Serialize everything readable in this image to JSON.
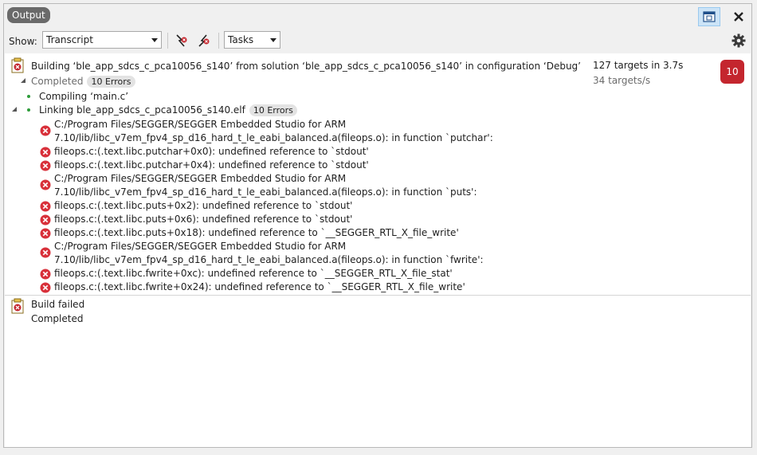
{
  "panel": {
    "title": "Output"
  },
  "toolbar": {
    "show_label": "Show:",
    "show_value": "Transcript",
    "tasks_value": "Tasks"
  },
  "build": {
    "header": "Building ‘ble_app_sdcs_c_pca10056_s140’ from solution ‘ble_app_sdcs_c_pca10056_s140’ in configuration ‘Debug’",
    "targets": "127 targets in 3.7s",
    "rate": "34 targets/s",
    "error_count": "10",
    "status": "Completed",
    "status_badge": "10 Errors",
    "compile": "Compiling ‘main.c’",
    "link": "Linking ble_app_sdcs_c_pca10056_s140.elf",
    "link_badge": "10 Errors"
  },
  "errors": [
    {
      "line1": "C:/Program Files/SEGGER/SEGGER Embedded Studio for ARM",
      "line2": "7.10/lib/libc_v7em_fpv4_sp_d16_hard_t_le_eabi_balanced.a(fileops.o): in function `putchar':"
    },
    {
      "line1": "fileops.c:(.text.libc.putchar+0x0): undefined reference to `stdout'"
    },
    {
      "line1": "fileops.c:(.text.libc.putchar+0x4): undefined reference to `stdout'"
    },
    {
      "line1": "C:/Program Files/SEGGER/SEGGER Embedded Studio for ARM",
      "line2": "7.10/lib/libc_v7em_fpv4_sp_d16_hard_t_le_eabi_balanced.a(fileops.o): in function `puts':"
    },
    {
      "line1": "fileops.c:(.text.libc.puts+0x2): undefined reference to `stdout'"
    },
    {
      "line1": "fileops.c:(.text.libc.puts+0x6): undefined reference to `stdout'"
    },
    {
      "line1": "fileops.c:(.text.libc.puts+0x18): undefined reference to `__SEGGER_RTL_X_file_write'"
    },
    {
      "line1": "C:/Program Files/SEGGER/SEGGER Embedded Studio for ARM",
      "line2": "7.10/lib/libc_v7em_fpv4_sp_d16_hard_t_le_eabi_balanced.a(fileops.o): in function `fwrite':"
    },
    {
      "line1": "fileops.c:(.text.libc.fwrite+0xc): undefined reference to `__SEGGER_RTL_X_file_stat'"
    },
    {
      "line1": "fileops.c:(.text.libc.fwrite+0x24): undefined reference to `__SEGGER_RTL_X_file_write'"
    }
  ],
  "result": {
    "title": "Build failed",
    "status": "Completed"
  },
  "icons": {
    "float": "float-window-icon",
    "close": "close-icon",
    "settings": "gear-icon",
    "next_error": "next-error-icon",
    "prev_error": "previous-error-icon",
    "error": "error-icon",
    "build_log": "build-log-icon"
  },
  "colors": {
    "error": "#c4262e",
    "ok": "#2e9c3a",
    "selected": "#cce4f7"
  }
}
